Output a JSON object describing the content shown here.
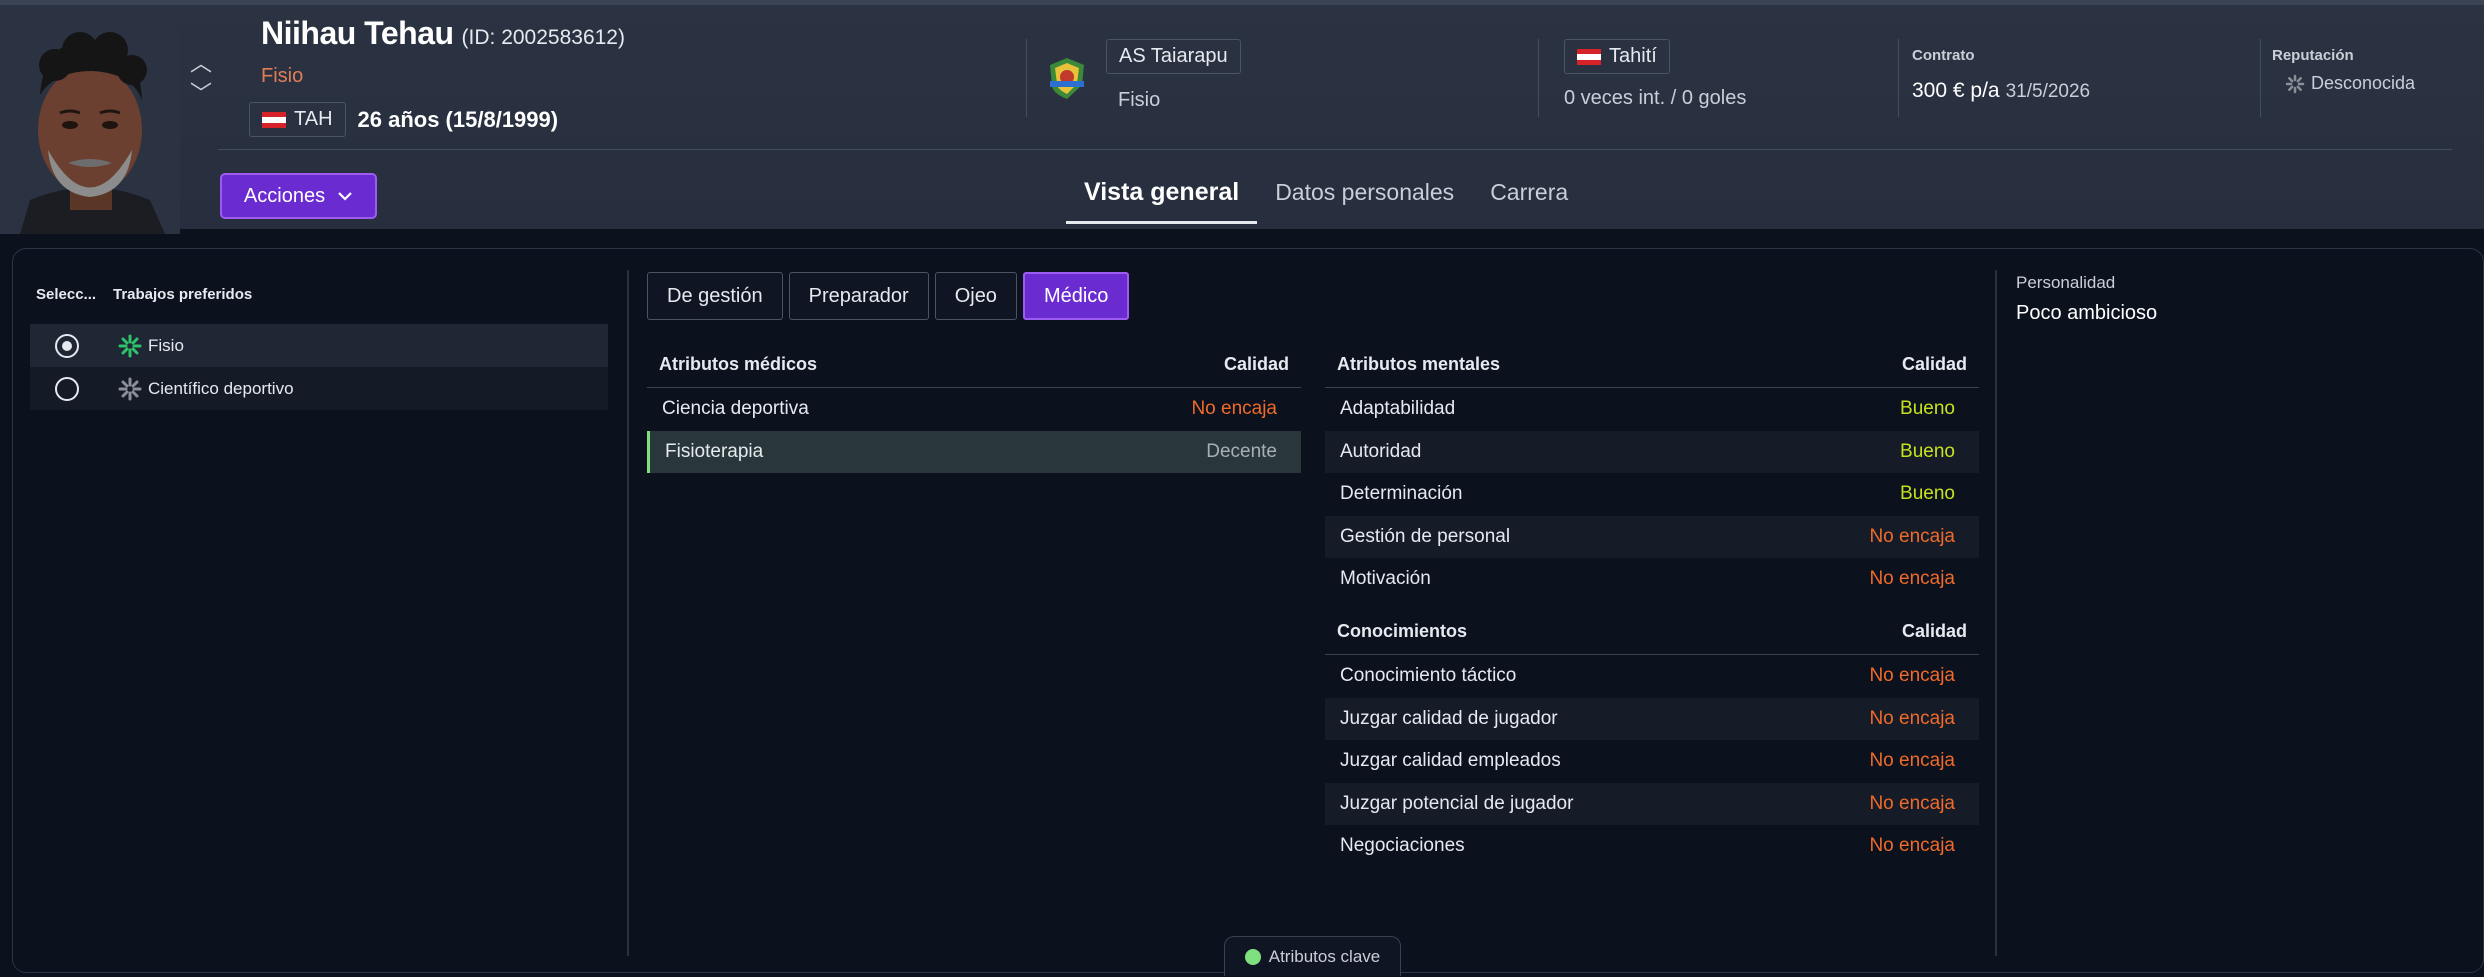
{
  "profile": {
    "name": "Niihau Tehau",
    "id_text": "(ID: 2002583612)",
    "role": "Fisio",
    "nationality_code": "TAH",
    "age_text": "26 años (15/8/1999)"
  },
  "club": {
    "name": "AS Taiarapu",
    "role": "Fisio"
  },
  "national": {
    "name": "Tahití",
    "caps": "0 veces int. / 0 goles"
  },
  "contract": {
    "label": "Contrato",
    "salary": "300 € p/a",
    "until": "31/5/2026"
  },
  "reputation": {
    "label": "Reputación",
    "value": "Desconocida"
  },
  "actions_label": "Acciones",
  "tabs": [
    {
      "label": "Vista general",
      "active": true
    },
    {
      "label": "Datos personales",
      "active": false
    },
    {
      "label": "Carrera",
      "active": false
    }
  ],
  "jobs": {
    "col_select": "Selecc...",
    "col_jobs": "Trabajos preferidos",
    "items": [
      {
        "label": "Fisio",
        "selected": true,
        "icon_color": "#2ec36a"
      },
      {
        "label": "Científico deportivo",
        "selected": false,
        "icon_color": "#8a8f99"
      }
    ]
  },
  "subtabs": [
    {
      "label": "De gestión",
      "active": false
    },
    {
      "label": "Preparador",
      "active": false
    },
    {
      "label": "Ojeo",
      "active": false
    },
    {
      "label": "Médico",
      "active": true
    }
  ],
  "medical": {
    "title": "Atributos médicos",
    "quality_header": "Calidad",
    "rows": [
      {
        "name": "Ciencia deportiva",
        "quality": "No encaja"
      },
      {
        "name": "Fisioterapia",
        "quality": "Decente"
      }
    ]
  },
  "mental": {
    "title": "Atributos mentales",
    "quality_header": "Calidad",
    "rows": [
      {
        "name": "Adaptabilidad",
        "quality": "Bueno"
      },
      {
        "name": "Autoridad",
        "quality": "Bueno"
      },
      {
        "name": "Determinación",
        "quality": "Bueno"
      },
      {
        "name": "Gestión de personal",
        "quality": "No encaja"
      },
      {
        "name": "Motivación",
        "quality": "No encaja"
      }
    ]
  },
  "knowledge": {
    "title": "Conocimientos",
    "quality_header": "Calidad",
    "rows": [
      {
        "name": "Conocimiento táctico",
        "quality": "No encaja"
      },
      {
        "name": "Juzgar calidad de jugador",
        "quality": "No encaja"
      },
      {
        "name": "Juzgar calidad empleados",
        "quality": "No encaja"
      },
      {
        "name": "Juzgar potencial de jugador",
        "quality": "No encaja"
      },
      {
        "name": "Negociaciones",
        "quality": "No encaja"
      }
    ]
  },
  "personality": {
    "label": "Personalidad",
    "value": "Poco ambicioso"
  },
  "key_attributes_label": "Atributos clave",
  "colors": {
    "accent": "#6a2bd0",
    "bad": "#f06a2a",
    "good": "#c6e21f",
    "neutral": "#a8adb7",
    "highlight": "#7ee07e"
  }
}
